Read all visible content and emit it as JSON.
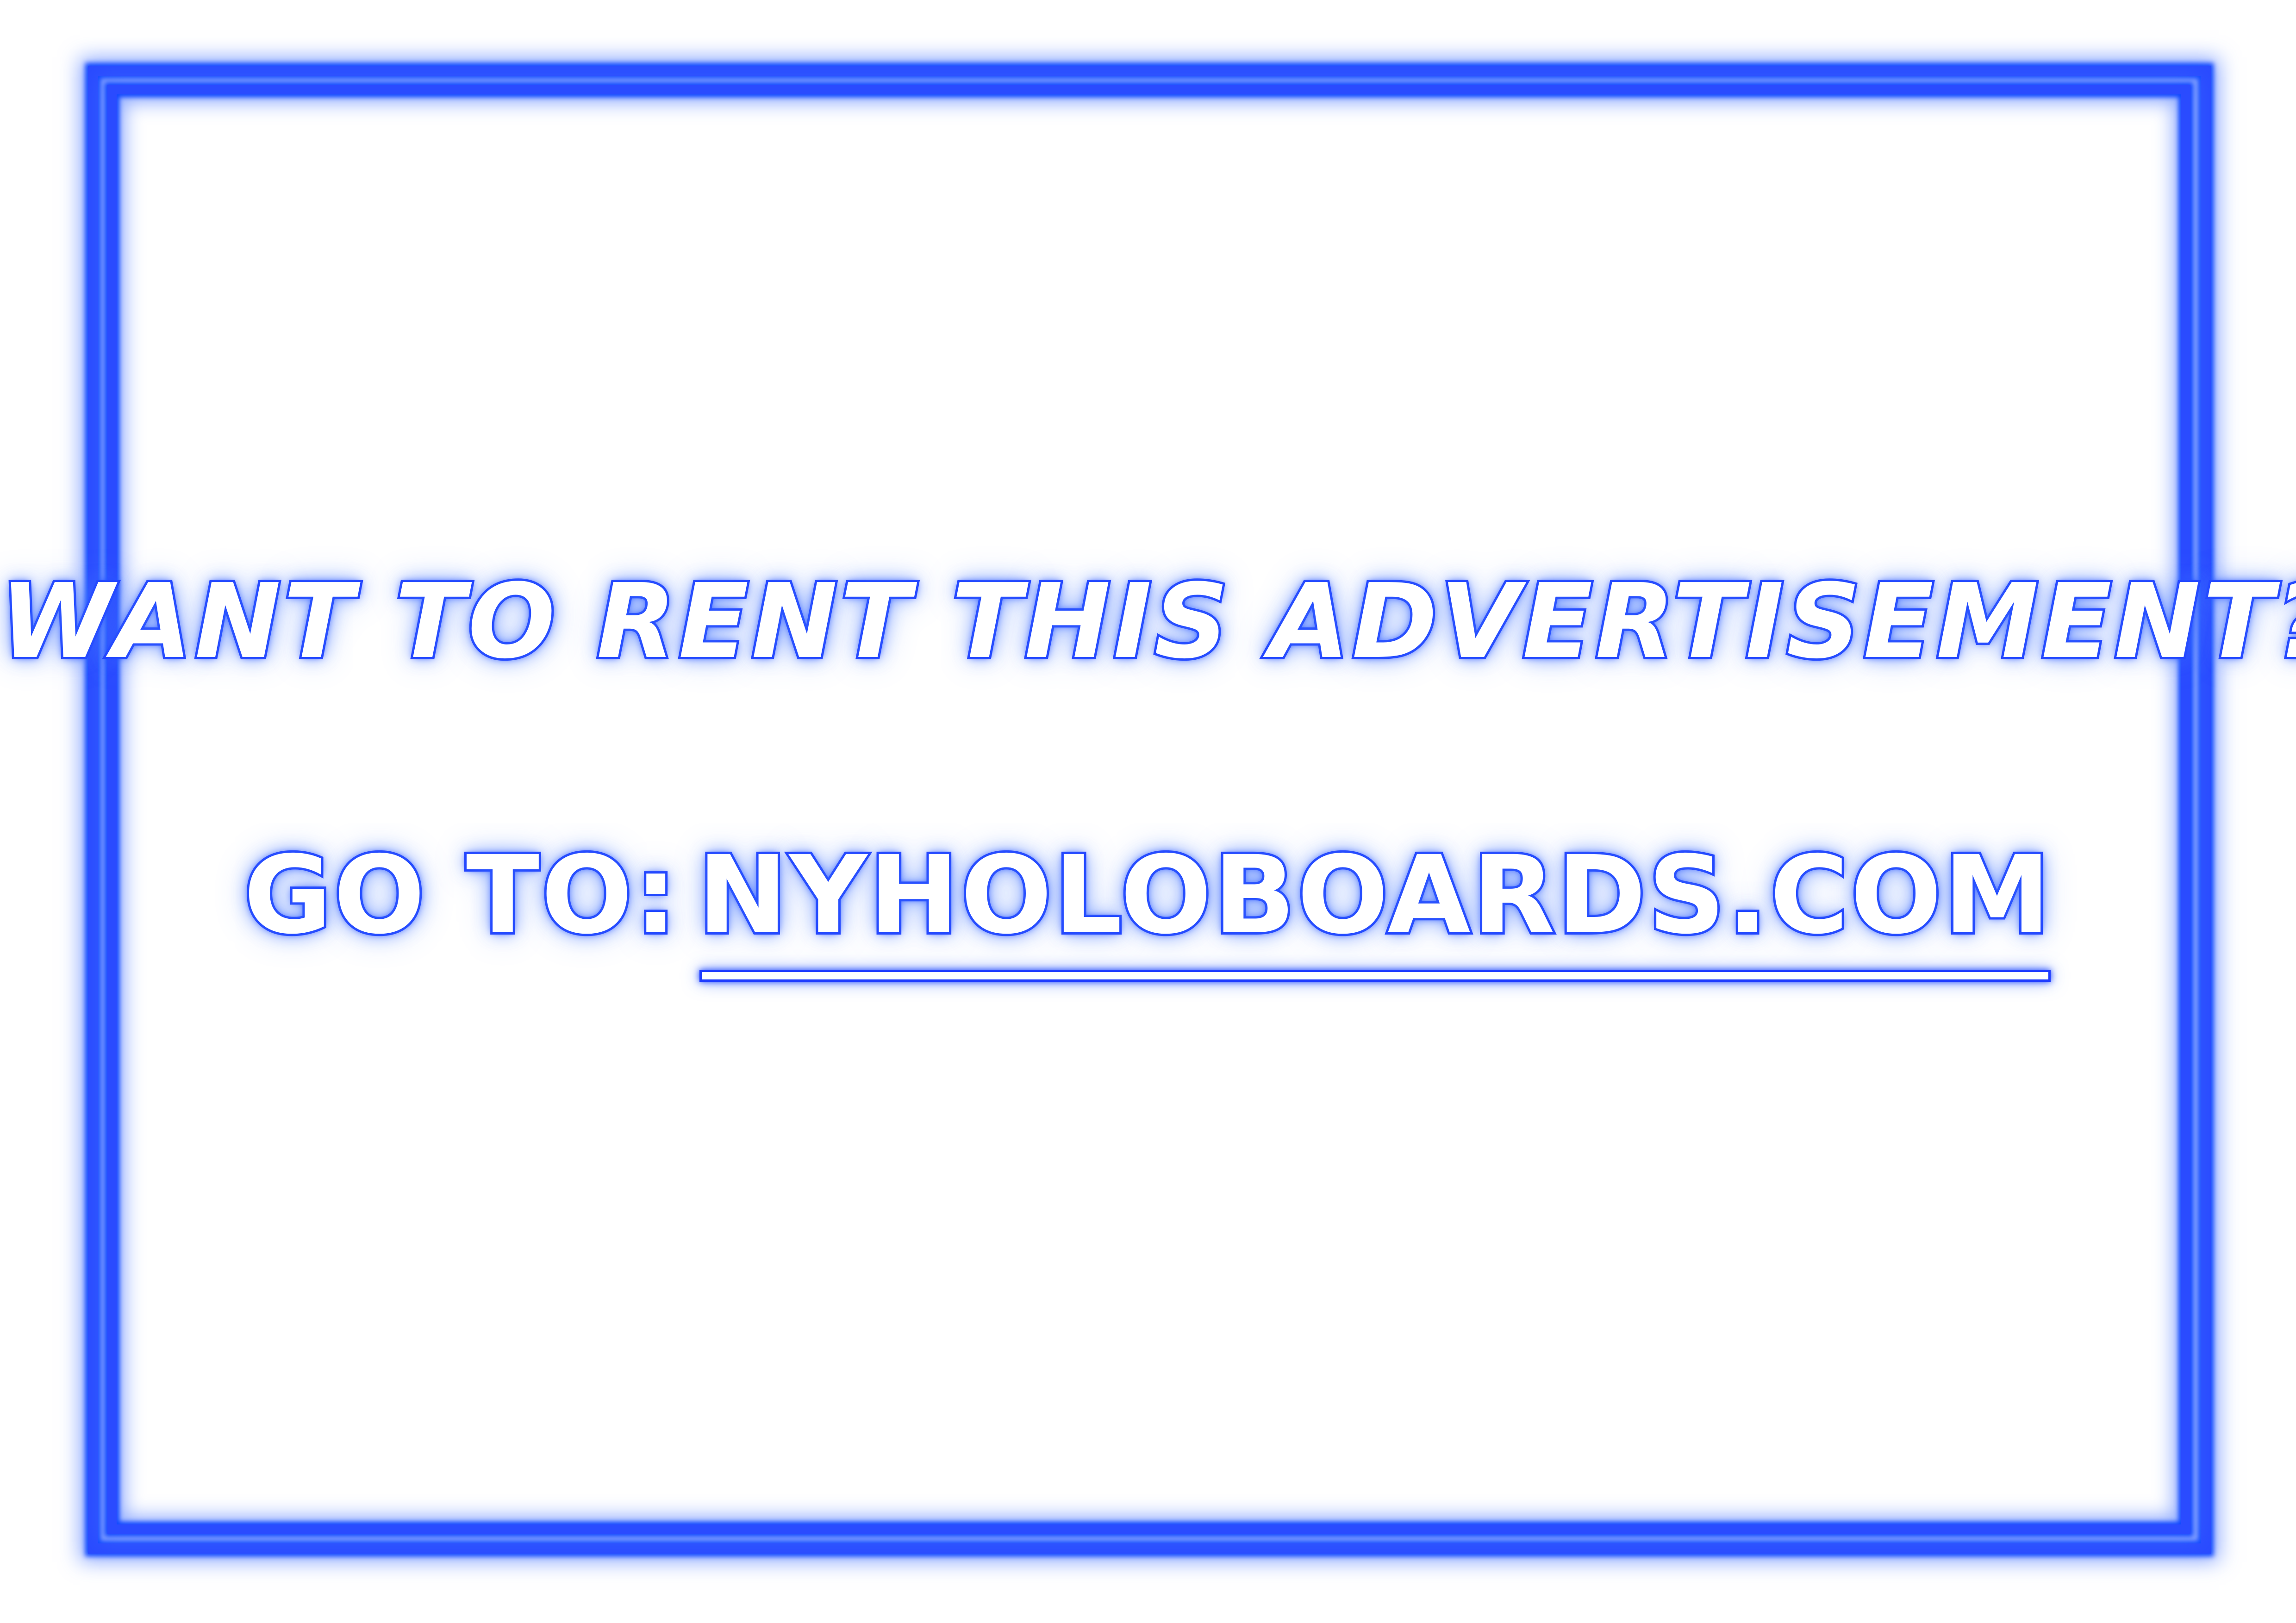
{
  "colors": {
    "background": "#ffffff",
    "neon_blue": "#1f3cff",
    "text_fill": "#ffffff"
  },
  "ad": {
    "headline": "WANT TO RENT THIS ADVERTISEMENT?",
    "cta_prefix": "GO TO:",
    "cta_link": "NYHOLOBOARDS.COM"
  }
}
